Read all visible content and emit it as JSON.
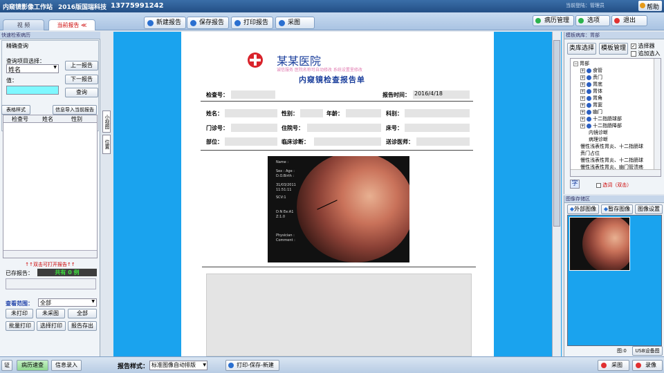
{
  "app": {
    "title": "内窥镜影像工作站",
    "version": "2016版",
    "company": "国瑞科技",
    "phone": "13775991242",
    "login": "当前登陆：管理员",
    "help": "帮助"
  },
  "tabs": [
    {
      "label": "视 频"
    },
    {
      "label": "当前报告 ≪"
    }
  ],
  "toolbar": {
    "new_report": "新建报告",
    "save_report": "保存报告",
    "print_report": "打印报告",
    "capture": "采图"
  },
  "right_buttons": {
    "history": "病历管理",
    "options": "选项",
    "exit": "退出"
  },
  "left": {
    "panel_title": "快速检索病历",
    "precise_query": "精确查询",
    "query_item_label": "查询项目选择：",
    "query_item_value": "姓名",
    "value_label": "值：",
    "prev_report": "上一报告",
    "next_report": "下一报告",
    "query": "查询",
    "table_style": "表格样式",
    "import_info": "信息导入当前报告",
    "columns": [
      "检查号",
      "姓名",
      "性别"
    ],
    "double_click_hint": "↑↑双击可打开报告↑↑",
    "saved_reports": "已存报告：",
    "total": "共有  0  例",
    "query_range": "查看范围：",
    "range_value": "全部",
    "not_printed": "未打印",
    "not_captured": "未采图",
    "all": "全部",
    "batch_print": "批量打印",
    "select_print": "选择打印",
    "report_save": "报告存出"
  },
  "side_tabs": [
    "小视图",
    "位置"
  ],
  "report": {
    "hospital": "某某医院",
    "hospital_sub": "诚信服务 医院名称可自动修改 系统设置里修改",
    "title": "内窥镜检查报告单",
    "check_no": "检查号：",
    "report_time_label": "报告时间：",
    "report_time": "2016/4/18",
    "name": "姓名：",
    "gender": "性别：",
    "age": "年龄：",
    "dept": "科别：",
    "clinic_no": "门诊号：",
    "inpatient_no": "住院号：",
    "bed_no": "床号：",
    "site": "部位：",
    "clinical_diag": "临床诊断：",
    "sending_doctor": "送诊医师：",
    "img_text": {
      "scope_name": "Name :",
      "sex_age": "Sex : Age :",
      "dob": "D.O.Birth :",
      "date": "31/03/2011",
      "time": "11:51:11",
      "scv": "SCV:1",
      "settings": "D:N Ee:A1",
      "zoom": "Z:1.0",
      "physician": "Physician :",
      "comment": "Comment :"
    }
  },
  "template": {
    "panel_title": "模板病库：胃部",
    "category_select": "类库选择",
    "template_manage": "模板管理",
    "selector": "选择器",
    "append": "追加选入",
    "tree": [
      "胃部",
      "食管",
      "贲门",
      "胃底",
      "胃体",
      "胃角",
      "胃窦",
      "幽门",
      "十二指肠球部",
      "十二指肠降部",
      "内镜诊断",
      "病理诊断",
      "慢性浅表性胃炎、十二指肠球",
      "贲门占位",
      "慢性浅表性胃炎、十二指肠球",
      "慢性浅表性胃炎、幽门管溃疡"
    ],
    "char_btn": "字",
    "select_dbl": "选词（双击）"
  },
  "image_store": {
    "panel_title": "图像存储区",
    "external": "外部图像",
    "pause": "暂存图像",
    "settings": "图像设置",
    "count": "图:0",
    "usb": "USB设备图像"
  },
  "bottom": {
    "cert": "证",
    "quick_search": "病历速查",
    "info_entry": "信息录入",
    "report_style_label": "报告样式：",
    "report_style_value": "标准图像自动排版",
    "print_save_new": "打印-保存-新建",
    "capture": "采图",
    "record": "录像"
  },
  "colors": {
    "accent": "#1aa3ee",
    "titlebar": "#234f85",
    "cyan_input": "#7ff8ff",
    "hospital_red": "#d9232b"
  }
}
